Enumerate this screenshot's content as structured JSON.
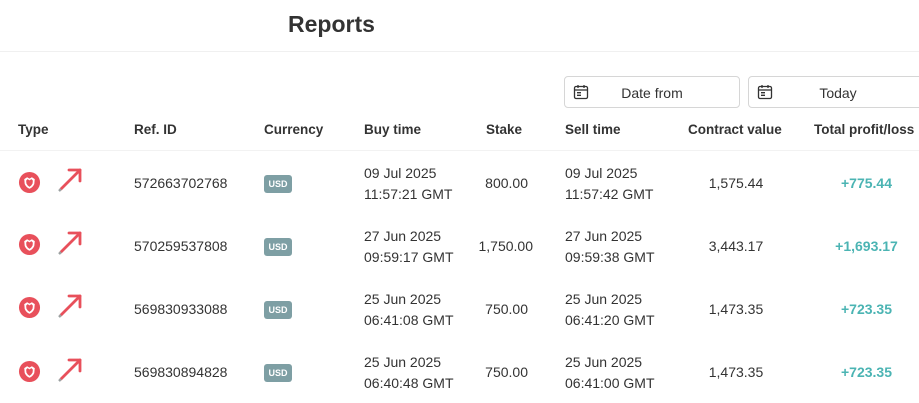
{
  "page": {
    "title": "Reports"
  },
  "filters": {
    "date_from": "Date from",
    "date_to": "Today"
  },
  "table": {
    "headers": {
      "type": "Type",
      "ref_id": "Ref. ID",
      "currency": "Currency",
      "buy_time": "Buy time",
      "stake": "Stake",
      "sell_time": "Sell time",
      "contract_value": "Contract value",
      "total_profit_loss": "Total profit/loss"
    },
    "rows": [
      {
        "ref_id": "572663702768",
        "currency": "USD",
        "buy_date": "09 Jul 2025",
        "buy_time": "11:57:21 GMT",
        "stake": "800.00",
        "sell_date": "09 Jul 2025",
        "sell_time": "11:57:42 GMT",
        "contract_value": "1,575.44",
        "profit": "+775.44"
      },
      {
        "ref_id": "570259537808",
        "currency": "USD",
        "buy_date": "27 Jun 2025",
        "buy_time": "09:59:17 GMT",
        "stake": "1,750.00",
        "sell_date": "27 Jun 2025",
        "sell_time": "09:59:38 GMT",
        "contract_value": "3,443.17",
        "profit": "+1,693.17"
      },
      {
        "ref_id": "569830933088",
        "currency": "USD",
        "buy_date": "25 Jun 2025",
        "buy_time": "06:41:08 GMT",
        "stake": "750.00",
        "sell_date": "25 Jun 2025",
        "sell_time": "06:41:20 GMT",
        "contract_value": "1,473.35",
        "profit": "+723.35"
      },
      {
        "ref_id": "569830894828",
        "currency": "USD",
        "buy_date": "25 Jun 2025",
        "buy_time": "06:40:48 GMT",
        "stake": "750.00",
        "sell_date": "25 Jun 2025",
        "sell_time": "06:41:00 GMT",
        "contract_value": "1,473.35",
        "profit": "+723.35"
      }
    ]
  },
  "icons": {
    "type": "accumulator-shield-icon",
    "direction": "arrow-up-right-icon",
    "calendar": "calendar-icon"
  },
  "colors": {
    "profit": "#4bb4b3",
    "type_icon": "#e8505b",
    "usd_badge": "#7e9fa4"
  }
}
